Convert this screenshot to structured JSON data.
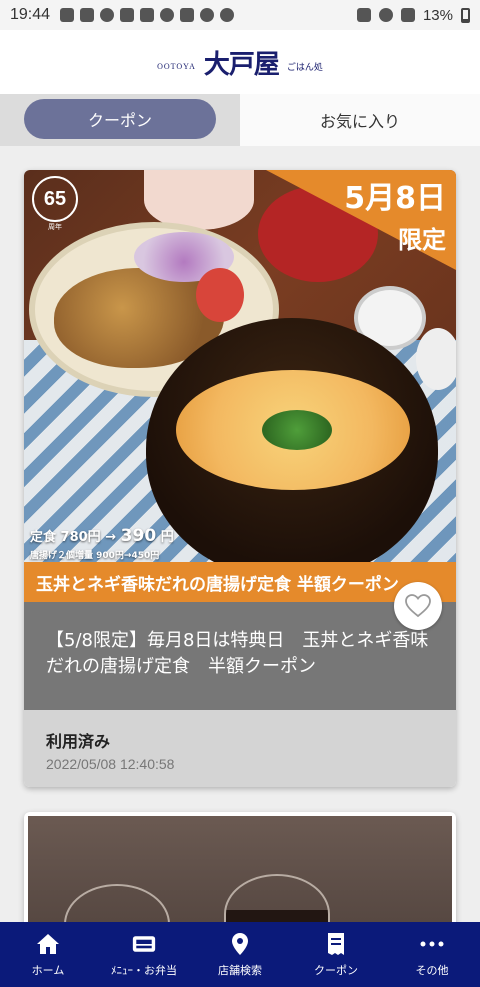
{
  "status_bar": {
    "time": "19:44",
    "battery": "13%"
  },
  "header": {
    "logo_small": "OOTOYA",
    "logo_main": "大戸屋",
    "logo_sub": "ごはん処"
  },
  "tabs": [
    {
      "label": "クーポン",
      "active": true
    },
    {
      "label": "お気に入り",
      "active": false
    }
  ],
  "coupon": {
    "badge": {
      "number": "65",
      "caption": "周年"
    },
    "promo": {
      "date": "5月8日",
      "limited": "限定"
    },
    "price": {
      "set_label": "定食",
      "old_price": "780円",
      "arrow": "→",
      "new_price": "390",
      "new_price_unit": "円",
      "extra": "唐揚げ２個増量 900円→450円"
    },
    "banner": "玉丼とネギ香味だれの唐揚げ定食 半額クーポン",
    "title": "【5/8限定】毎月8日は特典日　玉丼とネギ香味だれの唐揚げ定食　半額クーポン",
    "status": "利用済み",
    "used_at": "2022/05/08 12:40:58",
    "favorited": false
  },
  "bottom_nav": [
    {
      "label": "ホーム",
      "icon": "home-icon"
    },
    {
      "label": "ﾒﾆｭｰ・お弁当",
      "icon": "menu-icon"
    },
    {
      "label": "店舗検索",
      "icon": "location-pin-icon"
    },
    {
      "label": "クーポン",
      "icon": "coupon-icon"
    },
    {
      "label": "その他",
      "icon": "more-icon"
    }
  ],
  "colors": {
    "nav_bg": "#0b1a7a",
    "tab_active": "#6c7299",
    "promo_orange": "#e58a2b",
    "title_area": "#777777",
    "used_area": "#d4d4d4"
  }
}
